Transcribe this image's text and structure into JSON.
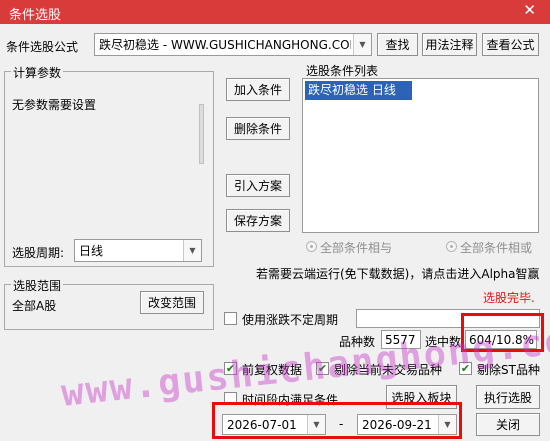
{
  "window": {
    "title": "条件选股",
    "close_glyph": "✕"
  },
  "formula": {
    "label": "条件选股公式",
    "value": "跌尽初稳选  -  WWW.GUSHICHANGHONG.COM",
    "buttons": {
      "find": "查找",
      "usage": "用法注释",
      "view": "查看公式"
    }
  },
  "params": {
    "group_title": "计算参数",
    "text": "无参数需要设置"
  },
  "period": {
    "label": "选股周期:",
    "value": "日线"
  },
  "actions": {
    "add": "加入条件",
    "delete": "删除条件",
    "import": "引入方案",
    "save": "保存方案"
  },
  "conditions": {
    "title": "选股条件列表",
    "items": [
      "跌尽初稳选  日线"
    ],
    "radio_and": "全部条件相与",
    "radio_or": "全部条件相或"
  },
  "cloud_note": "若需要云端运行(免下载数据)，请点击进入Alpha智赢",
  "status": {
    "text": "选股完毕.",
    "color": "#e01515"
  },
  "range": {
    "group_title": "选股范围",
    "text": "全部A股",
    "change_button": "改变范围"
  },
  "uncertain_period": {
    "label": "使用涨跌不定周期",
    "checked": false
  },
  "counts": {
    "total_label": "品种数",
    "total_value": "5577",
    "selected_label": "选中数",
    "selected_value": "604/10.8%"
  },
  "options": {
    "pre_adjust": {
      "label": "前复权数据",
      "checked": true
    },
    "exclude_untraded": {
      "label": "剔除当前未交易品种",
      "checked": true
    },
    "exclude_st": {
      "label": "剔除ST品种",
      "checked": true
    },
    "time_range": {
      "label": "时间段内满足条件",
      "checked": false
    }
  },
  "bottom_buttons": {
    "to_board": "选股入板块",
    "execute": "执行选股",
    "close": "关闭"
  },
  "dates": {
    "start": "2026-07-01",
    "separator": "-",
    "end": "2026-09-21"
  },
  "watermark": "www.gushichanghong.com",
  "highlight_color": "#e80c0c"
}
